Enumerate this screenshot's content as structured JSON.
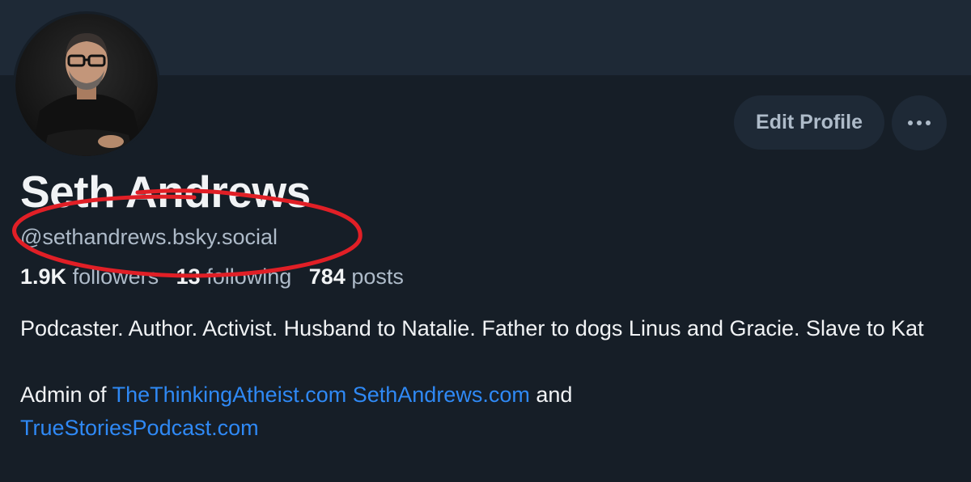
{
  "profile": {
    "name": "Seth Andrews",
    "handle": "@sethandrews.bsky.social",
    "avatar_icon": "person-portrait-icon"
  },
  "actions": {
    "edit_label": "Edit Profile",
    "more_icon": "more-horizontal-icon"
  },
  "stats": {
    "followers_count": "1.9K",
    "followers_label": "followers",
    "following_count": "13",
    "following_label": "following",
    "posts_count": "784",
    "posts_label": "posts"
  },
  "bio": {
    "line1": "Podcaster. Author. Activist. Husband to Natalie. Father to dogs Linus and Gracie. Slave to Kat",
    "admin_prefix": "Admin of ",
    "link1": "TheThinkingAtheist.com",
    "link2": "SethAndrews.com",
    "and_text": " and ",
    "link3": "TrueStoriesPodcast.com"
  },
  "colors": {
    "background": "#161e27",
    "banner": "#1e2936",
    "link": "#2f89f5",
    "annotation": "#e11f26"
  }
}
